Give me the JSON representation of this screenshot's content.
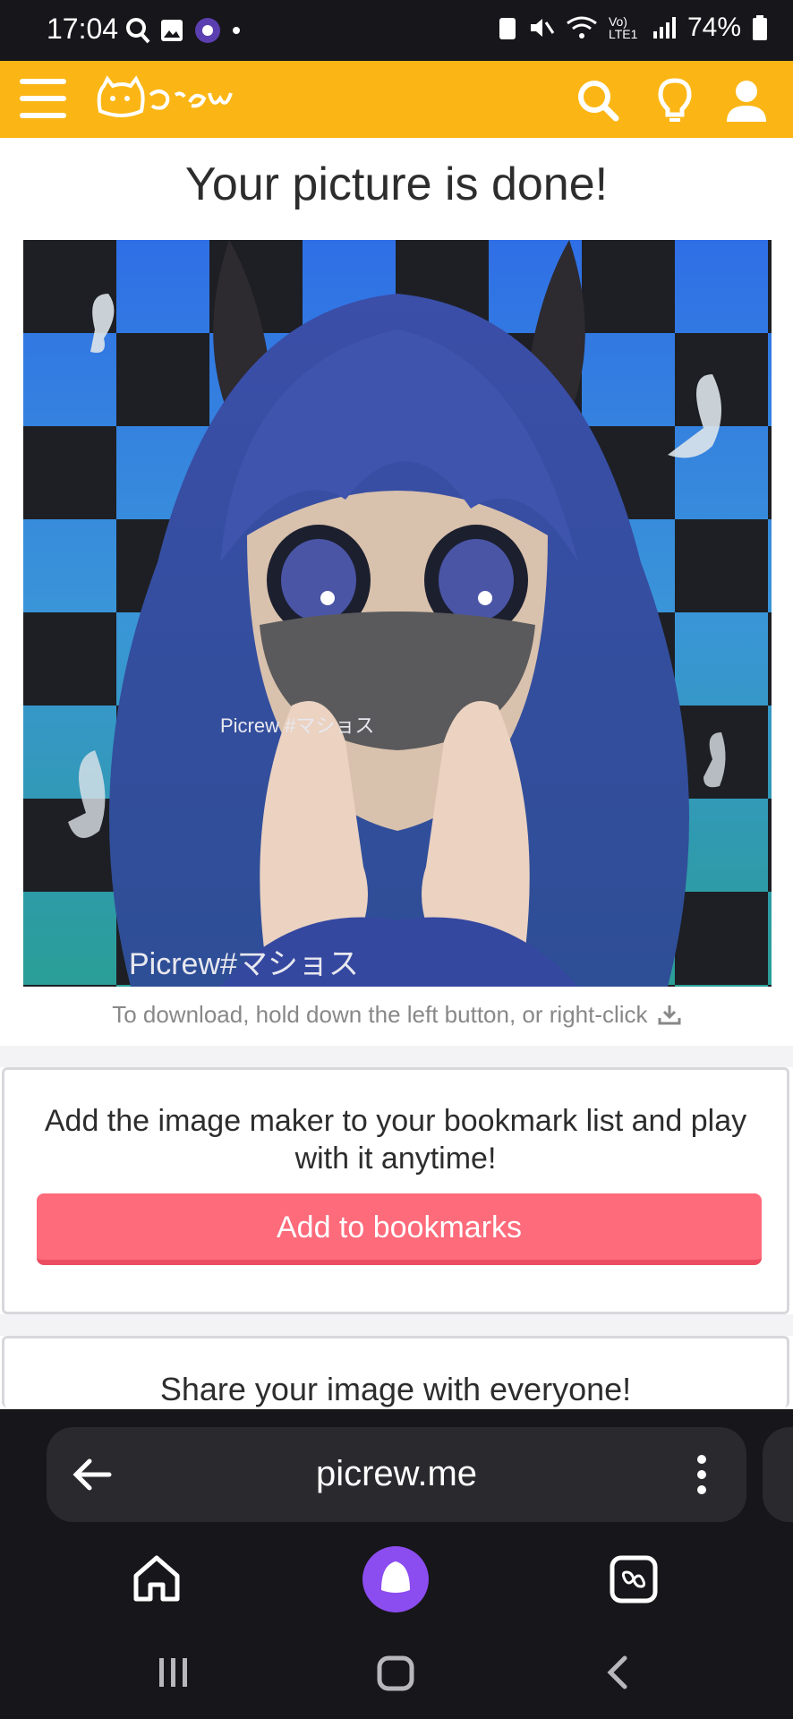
{
  "status_bar": {
    "time": "17:04",
    "battery": "74%",
    "network": "Vo) LTE1"
  },
  "app": {
    "logo_text": "Picrew",
    "brand_color": "#fbb615"
  },
  "main": {
    "title": "Your picture is done!",
    "image_watermarks": [
      "Picrew #マショス",
      "Picrew#マショス"
    ],
    "download_hint": "To download, hold down the left button, or right-click",
    "bookmark_card": {
      "text": "Add the image maker to your bookmark list and play with it anytime!",
      "button_label": "Add to bookmarks",
      "button_color": "#fe6b7b"
    },
    "share_card": {
      "text": "Share your image with everyone!"
    }
  },
  "browser": {
    "url": "picrew.me"
  },
  "icons": [
    "search-icon",
    "image-icon",
    "app-icon",
    "lightbulb-icon",
    "user-icon",
    "back-arrow-icon",
    "more-icon",
    "home-icon",
    "assistant-icon",
    "tabs-icon",
    "recents-icon",
    "android-home-icon",
    "android-back-icon"
  ]
}
